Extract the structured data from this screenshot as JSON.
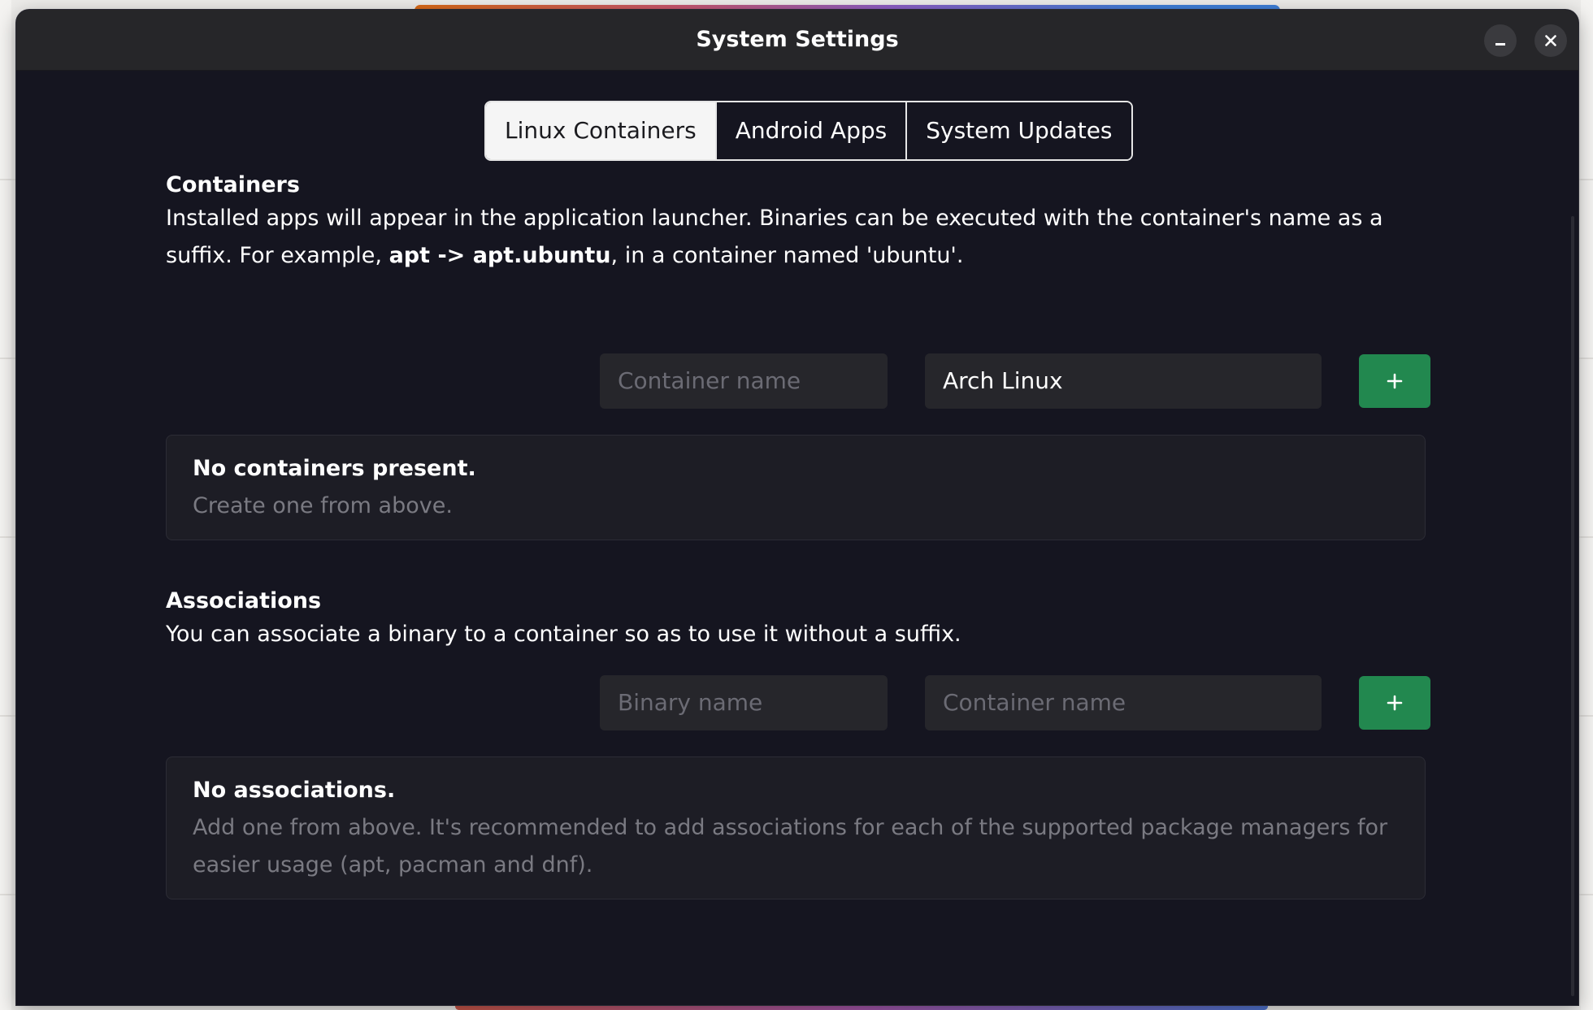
{
  "window": {
    "title": "System Settings",
    "minimize_label": "minimize",
    "close_label": "close"
  },
  "tabs": [
    {
      "label": "Linux Containers",
      "active": true
    },
    {
      "label": "Android Apps",
      "active": false
    },
    {
      "label": "System Updates",
      "active": false
    }
  ],
  "containers": {
    "title": "Containers",
    "description_line1": "Installed apps will appear in the application launcher. Binaries can be executed with the container's name as a",
    "description_line2_prefix": "suffix. For example, ",
    "description_cmd": "apt",
    "description_arrow": " -> ",
    "description_result": "apt.ubuntu",
    "description_suffix": ", in a container named 'ubuntu'.",
    "name_input": {
      "value": "",
      "placeholder": "Container name"
    },
    "distro_select": {
      "value": "Arch Linux"
    },
    "add_button_label": "+",
    "empty": {
      "title": "No containers present.",
      "subtitle": "Create one from above."
    }
  },
  "associations": {
    "title": "Associations",
    "description": "You can associate a binary to a container so as to use it without a suffix.",
    "binary_input": {
      "value": "",
      "placeholder": "Binary name"
    },
    "container_input": {
      "value": "",
      "placeholder": "Container name"
    },
    "add_button_label": "+",
    "empty": {
      "title": "No associations.",
      "subtitle_line1": "Add one from above. It's recommended to add associations for each of the supported package managers for",
      "subtitle_line2": "easier usage (apt, pacman and dnf)."
    }
  },
  "colors": {
    "window_bg": "#151520",
    "titlebar_bg": "#262629",
    "input_bg": "#26262b",
    "accent_green": "#22884f",
    "muted_text": "#7a7a82"
  }
}
